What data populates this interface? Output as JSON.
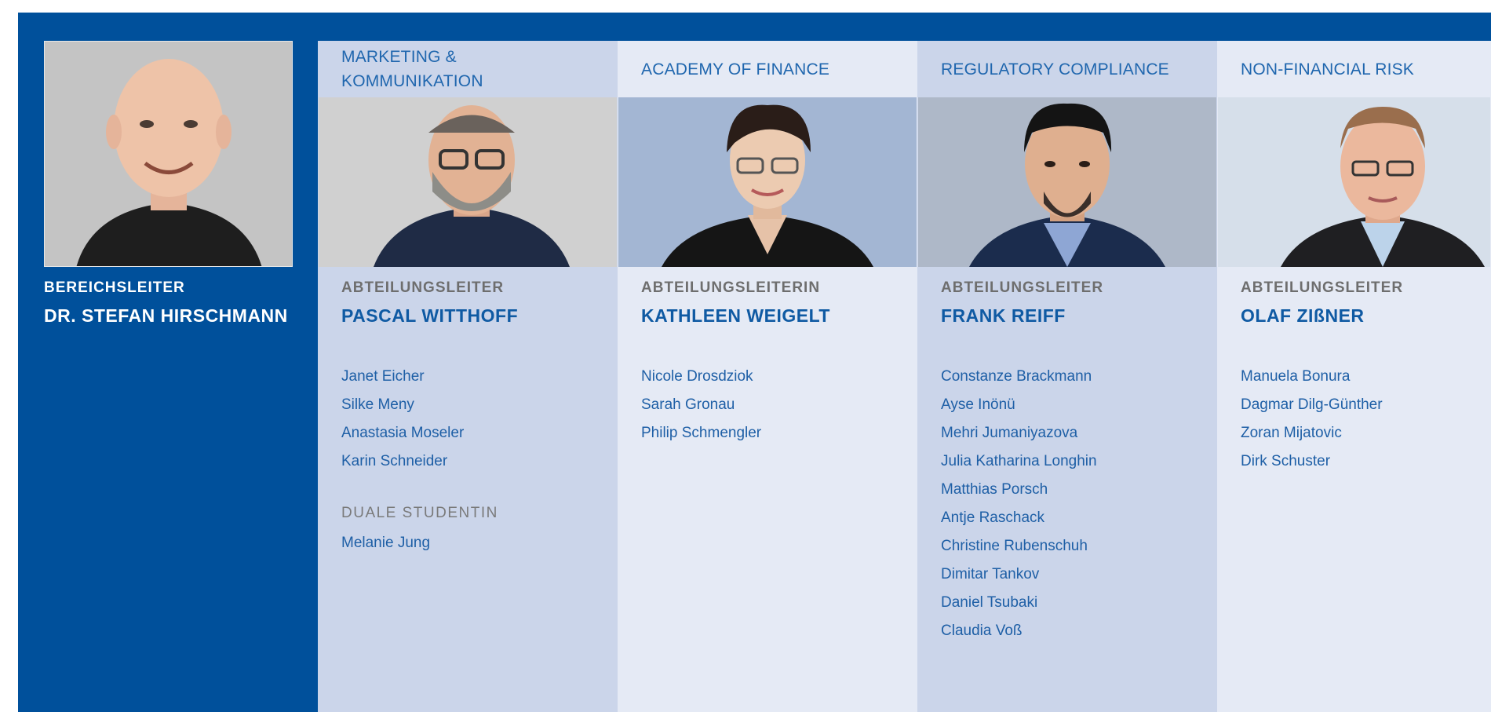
{
  "leader": {
    "role": "BEREICHSLEITER",
    "name": "DR. STEFAN HIRSCHMANN",
    "photo": "portrait-bald-man-black-shirt"
  },
  "departments": [
    {
      "header_line1": "MARKETING &",
      "header_line2": "KOMMUNIKATION",
      "role": "ABTEILUNGSLEITER",
      "name": "PASCAL WITTHOFF",
      "photo": "portrait-man-glasses-beard",
      "members": [
        "Janet Eicher",
        "Silke Meny",
        "Anastasia Moseler",
        "Karin Schneider"
      ],
      "sub_role": "DUALE STUDENTIN",
      "sub_members": [
        "Melanie Jung"
      ]
    },
    {
      "header_line1": "ACADEMY OF FINANCE",
      "role": "ABTEILUNGSLEITERIN",
      "name": "KATHLEEN WEIGELT",
      "photo": "portrait-woman-glasses",
      "members": [
        "Nicole Drosdziok",
        "Sarah Gronau",
        "Philip Schmengler"
      ]
    },
    {
      "header_line1": "REGULATORY COMPLIANCE",
      "role": "ABTEILUNGSLEITER",
      "name": "FRANK REIFF",
      "photo": "portrait-man-dark-hair-goatee",
      "members": [
        "Constanze Brackmann",
        "Ayse Inönü",
        "Mehri Jumaniyazova",
        "Julia Katharina Longhin",
        "Matthias Porsch",
        "Antje Raschack",
        "Christine Rubenschuh",
        "Dimitar Tankov",
        "Daniel Tsubaki",
        "Claudia Voß"
      ]
    },
    {
      "header_line1": "NON-FINANCIAL RISK",
      "role": "ABTEILUNGSLEITER",
      "name": "OLAF ZIßNER",
      "photo": "portrait-man-glasses-suit",
      "members": [
        "Manuela Bonura",
        "Dagmar Dilg-Günther",
        "Zoran Mijatovic",
        "Dirk Schuster"
      ]
    }
  ],
  "colors": {
    "brand_blue": "#00509b",
    "column_dark": "#cbd5ea",
    "column_light": "#e5eaf5",
    "name_blue": "#0f5aa3",
    "role_grey": "#6e6e6e"
  }
}
